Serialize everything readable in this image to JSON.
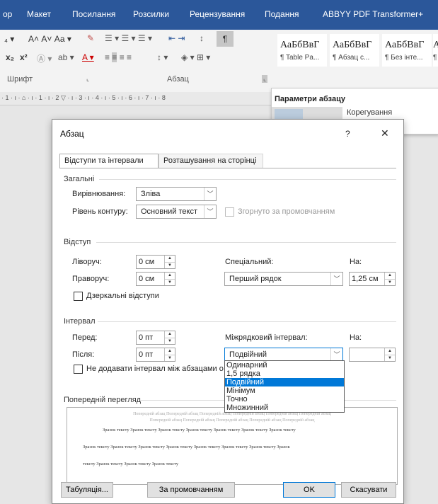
{
  "ribbon": {
    "tabs": [
      "ор",
      "Макет",
      "Посилання",
      "Розсилки",
      "Рецензування",
      "Подання",
      "ABBYY PDF Transformer+"
    ],
    "font_group_label": "Шрифт",
    "paragraph_group_label": "Абзац",
    "font_row1": "А˄ А˅  Аа ▾",
    "font_row2_sub": "x₂",
    "font_row2_sup": "x²",
    "styles": [
      {
        "sample": "АаБбВвГ",
        "name": "¶ Table Pa..."
      },
      {
        "sample": "АаБбВвГ",
        "name": "¶ Абзац с..."
      },
      {
        "sample": "АаБбВвГ",
        "name": "¶ Без інте..."
      }
    ],
    "style_partial_sample": "А",
    "style_partial_name": "¶",
    "ruler_text": "· 1 · ı · ⌂ · ı · 1 · ı · 2 ▽ · ı · 3 · ı · 4 · ı · 5 · ı · 6 · ı · 7 · ı · 8",
    "tooltip": {
      "title": "Параметри абзацу",
      "subtitle": "Корегування"
    }
  },
  "dialog": {
    "title": "Абзац",
    "help": "?",
    "close": "✕",
    "tabs": {
      "indents": "Відступи та інтервали",
      "page": "Розташування на сторінці"
    },
    "general": {
      "section": "Загальні",
      "alignment_label": "Вирівнювання:",
      "alignment_value": "Зліва",
      "outline_label": "Рівень контуру:",
      "outline_value": "Основний текст",
      "collapsed_label": "Згорнуто за промовчанням"
    },
    "indent": {
      "section": "Відступ",
      "left_label": "Ліворуч:",
      "left_value": "0 см",
      "right_label": "Праворуч:",
      "right_value": "0 см",
      "special_label": "Спеціальний:",
      "special_value": "Перший рядок",
      "by_label": "На:",
      "by_value": "1,25 см",
      "mirror_label": "Дзеркальні відступи"
    },
    "spacing": {
      "section": "Інтервал",
      "before_label": "Перед:",
      "before_value": "0 пт",
      "after_label": "Після:",
      "after_value": "0 пт",
      "line_label": "Міжрядковий інтервал:",
      "line_value": "Подвійний",
      "at_label": "На:",
      "at_value": "",
      "no_space_label": "Не додавати інтервал між абзацами о",
      "options": [
        "Одинарний",
        "1,5 рядка",
        "Подвійний",
        "Мінімум",
        "Точно",
        "Множинний"
      ],
      "selected_index": 2
    },
    "preview": {
      "section": "Попередній перегляд",
      "prev_line1": "Попередній абзац Попередній абзац Попередній абзац Попередній абзац Попередній абзац Попередній абзац",
      "prev_line2": "Попередній абзац Попередній абзац Попередній абзац Попередній абзац Попередній абзац",
      "sample_line1": "Зразок тексту Зразок тексту Зразок тексту Зразок тексту Зразок тексту Зразок тексту Зразок тексту",
      "sample_line2": "Зразок тексту Зразок тексту Зразок тексту Зразок тексту Зразок тексту Зразок тексту Зразок тексту Зразок",
      "sample_line3": "тексту Зразок тексту Зразок тексту Зразок тексту"
    },
    "buttons": {
      "tabs": "Табуляція...",
      "default": "За промовчанням",
      "ok": "OK",
      "cancel": "Скасувати"
    }
  }
}
